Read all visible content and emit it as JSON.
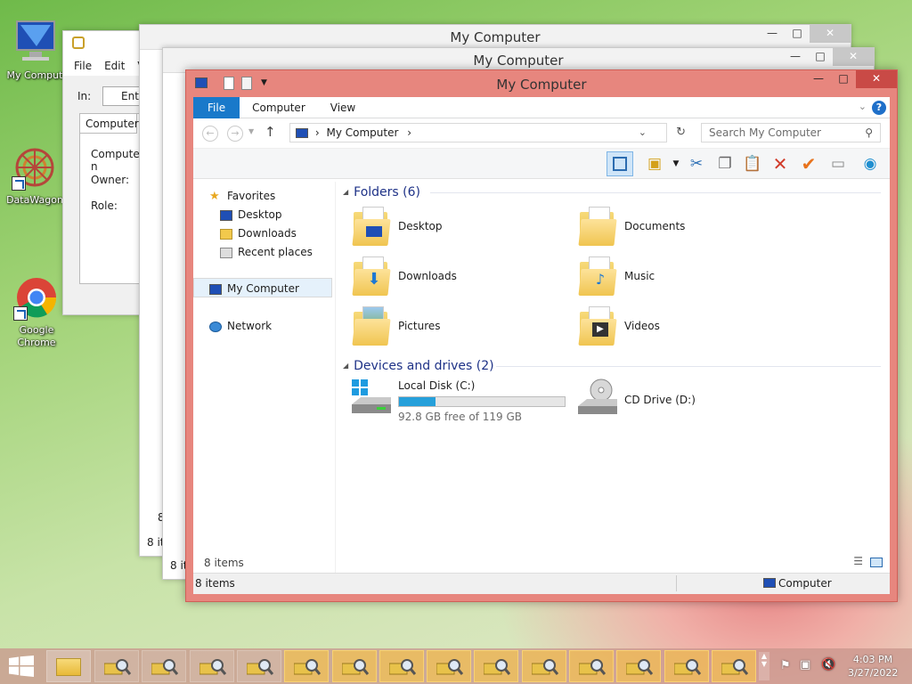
{
  "desktop": {
    "icons": [
      {
        "label": "My Comput",
        "icon": "computer-icon"
      },
      {
        "label": "DataWagon",
        "icon": "datawagon-icon"
      },
      {
        "label": "Google Chrome",
        "icon": "chrome-icon"
      }
    ]
  },
  "back_window": {
    "menu": [
      "File",
      "Edit",
      "V"
    ],
    "in_label": "In:",
    "in_value": "Enti",
    "tab": "Computers",
    "fields": [
      "Computer n",
      "Owner:",
      "Role:"
    ],
    "count_label_a": "8",
    "count_label_b": "8 it"
  },
  "mid_window_1": {
    "title": "My Computer",
    "status": "8 it"
  },
  "mid_window_2": {
    "title": "My Computer",
    "status": "8 it"
  },
  "window": {
    "title": "My Computer",
    "controls": {
      "minimize": "—",
      "maximize": "□",
      "close": "✕"
    },
    "ribbon_tabs": [
      "File",
      "Computer",
      "View"
    ],
    "address": {
      "path": "My Computer",
      "separator": "›"
    },
    "search_placeholder": "Search My Computer",
    "nav": {
      "favorites": "Favorites",
      "desktop": "Desktop",
      "downloads": "Downloads",
      "recent": "Recent places",
      "computer": "My Computer",
      "network": "Network"
    },
    "folders_header": "Folders (6)",
    "folders": [
      {
        "name": "Desktop",
        "icon": "desktop-folder-icon"
      },
      {
        "name": "Documents",
        "icon": "documents-folder-icon"
      },
      {
        "name": "Downloads",
        "icon": "downloads-folder-icon"
      },
      {
        "name": "Music",
        "icon": "music-folder-icon"
      },
      {
        "name": "Pictures",
        "icon": "pictures-folder-icon"
      },
      {
        "name": "Videos",
        "icon": "videos-folder-icon"
      }
    ],
    "devices_header": "Devices and drives (2)",
    "drives": [
      {
        "name": "Local Disk (C:)",
        "free_text": "92.8 GB free of 119 GB",
        "used_fraction": 0.22,
        "icon": "hard-disk-icon"
      },
      {
        "name": "CD Drive (D:)",
        "icon": "cd-drive-icon"
      }
    ],
    "items_count": "8 items",
    "status": {
      "left": "8 items",
      "right": "Computer"
    }
  },
  "taskbar": {
    "clock_time": "4:03 PM",
    "clock_date": "3/27/2022",
    "accent": "#1979ca"
  }
}
